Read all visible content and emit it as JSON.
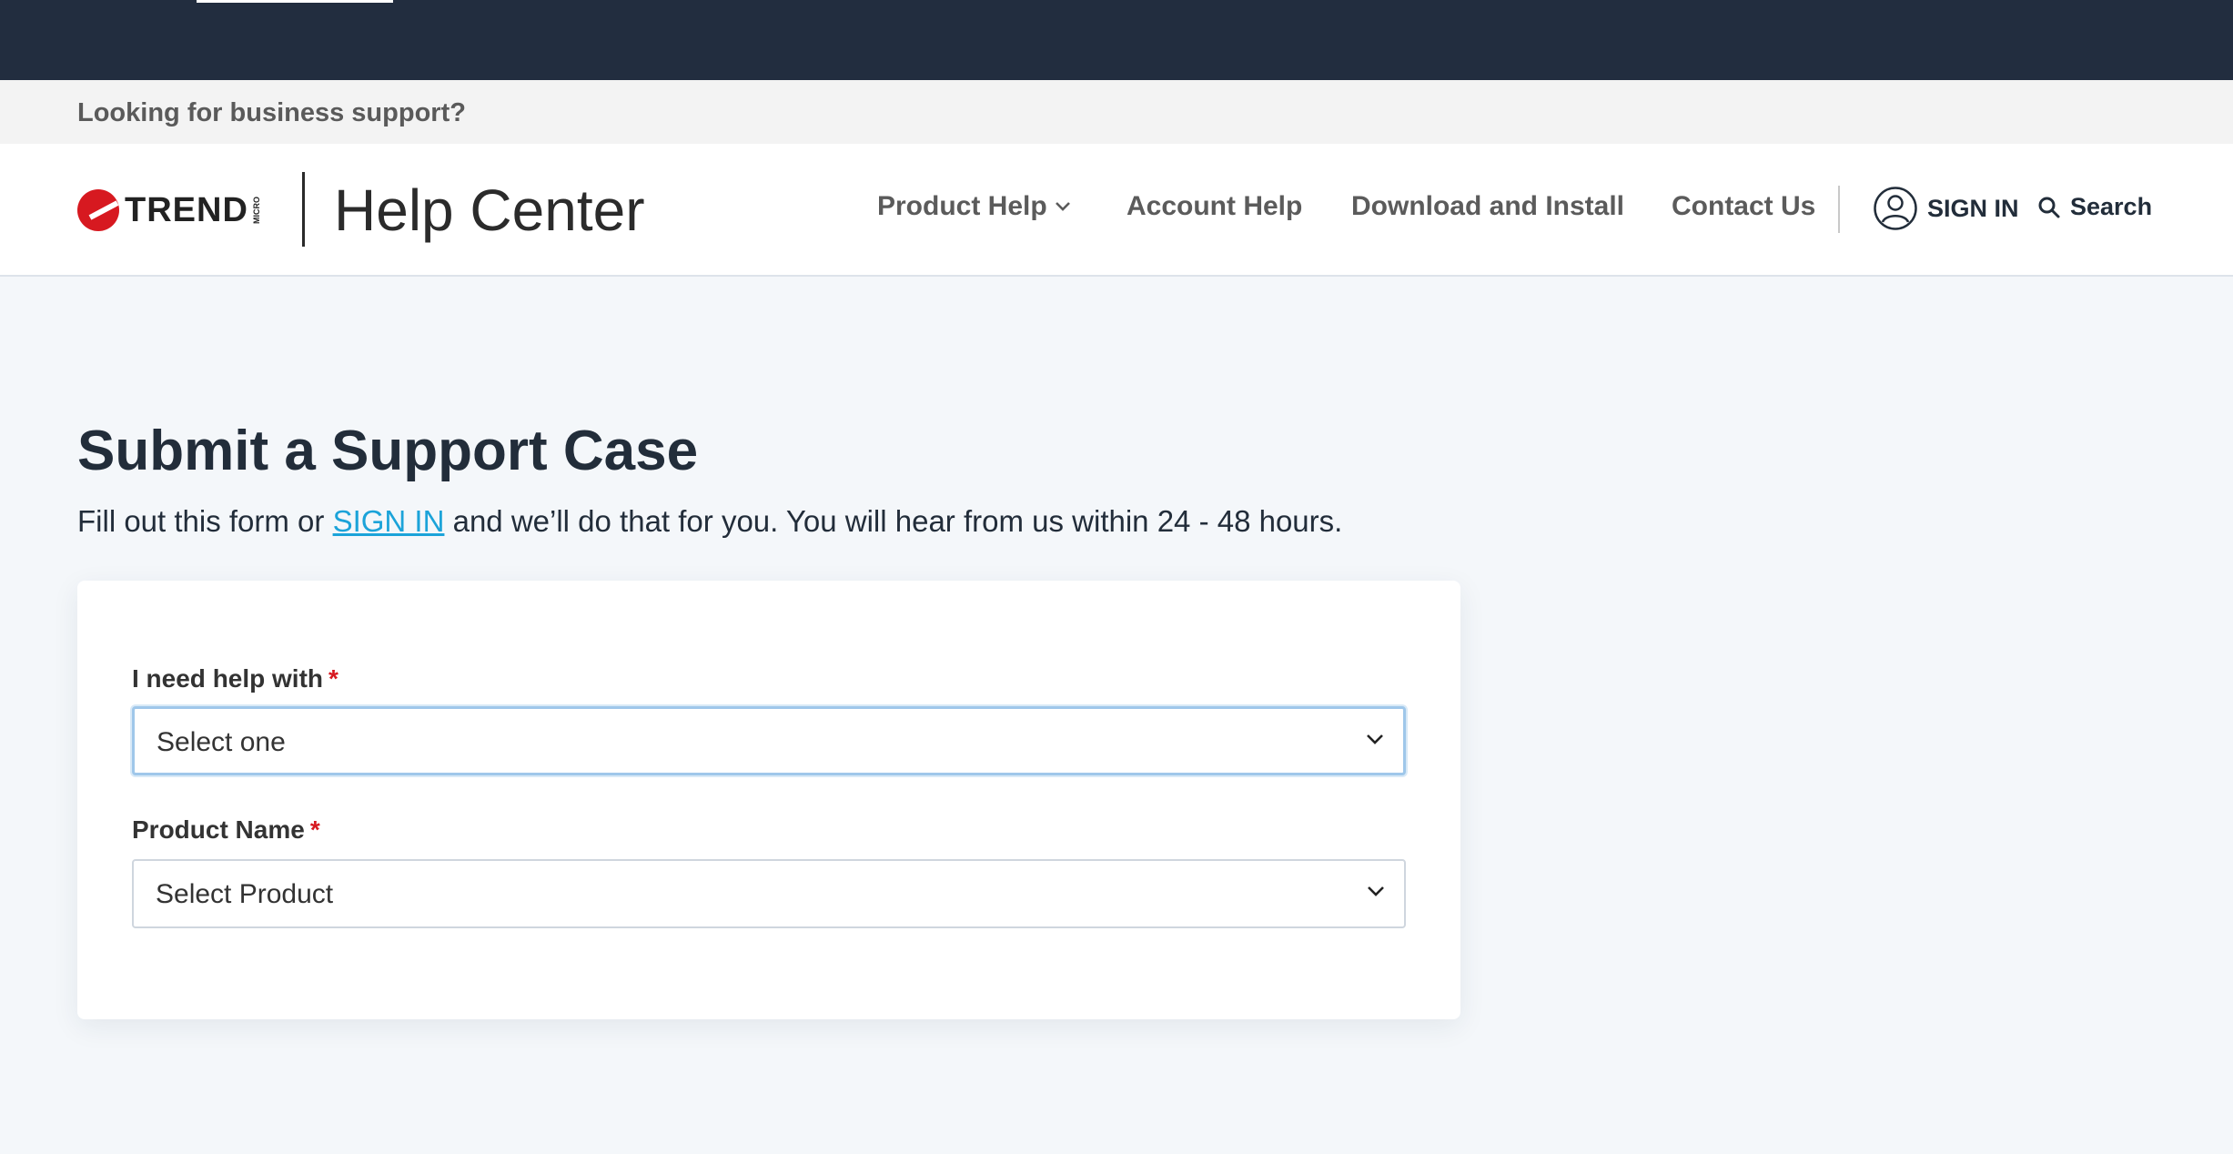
{
  "banner": {
    "text": "Looking for business support?"
  },
  "header": {
    "logo_text": "TREND",
    "logo_sub": "MICRO",
    "site_title": "Help Center",
    "nav": {
      "product_help": "Product Help",
      "account_help": "Account Help",
      "download_install": "Download and Install",
      "contact_us": "Contact Us"
    },
    "sign_in": "SIGN IN",
    "search": "Search"
  },
  "main": {
    "title": "Submit a Support Case",
    "intro_before": "Fill out this form or ",
    "intro_link": "SIGN IN",
    "intro_after": " and we’ll do that for you. You will hear from us within 24 - 48 hours."
  },
  "form": {
    "help_with": {
      "label": "I need help with",
      "required": "*",
      "value": "Select one"
    },
    "product_name": {
      "label": "Product Name",
      "required": "*",
      "value": "Select Product"
    }
  },
  "colors": {
    "topbar": "#222d3f",
    "brand_red": "#d71920",
    "link": "#1ba3d9",
    "page_bg": "#f4f7fa"
  },
  "icons": [
    "chevron-down-icon",
    "user-icon",
    "search-icon"
  ]
}
